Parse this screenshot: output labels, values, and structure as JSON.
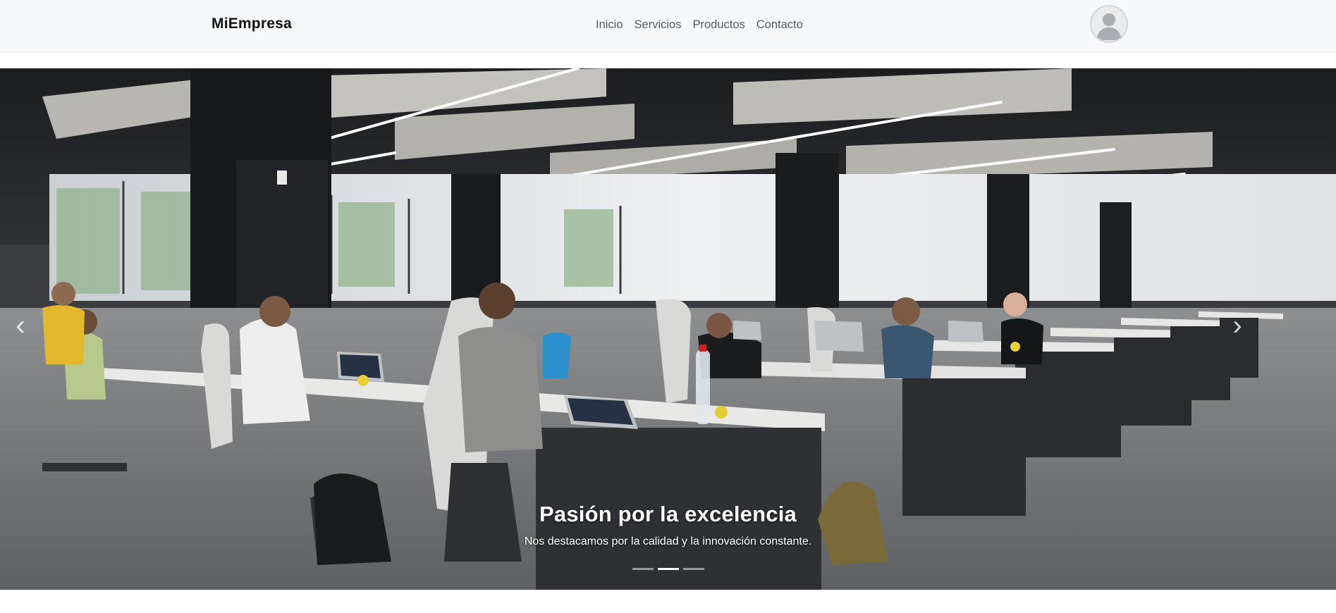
{
  "navbar": {
    "brand": "MiEmpresa",
    "links": [
      "Inicio",
      "Servicios",
      "Productos",
      "Contacto"
    ],
    "avatar_icon": "user-avatar-icon"
  },
  "carousel": {
    "slide_title": "Pasión por la excelencia",
    "slide_text": "Nos destacamos por la calidad y la innovación constante.",
    "indicator_count": 3,
    "active_indicator": 2,
    "prev_icon": "chevron-left-icon",
    "next_icon": "chevron-right-icon",
    "next_glyph": "›",
    "prev_glyph": "‹",
    "image_description_icon": "office-coworking-photo"
  },
  "colors": {
    "navbar_bg": "#f8f9fa",
    "brand_text": "#111111",
    "nav_link": "#555a5f",
    "caption_text": "#ffffff"
  }
}
